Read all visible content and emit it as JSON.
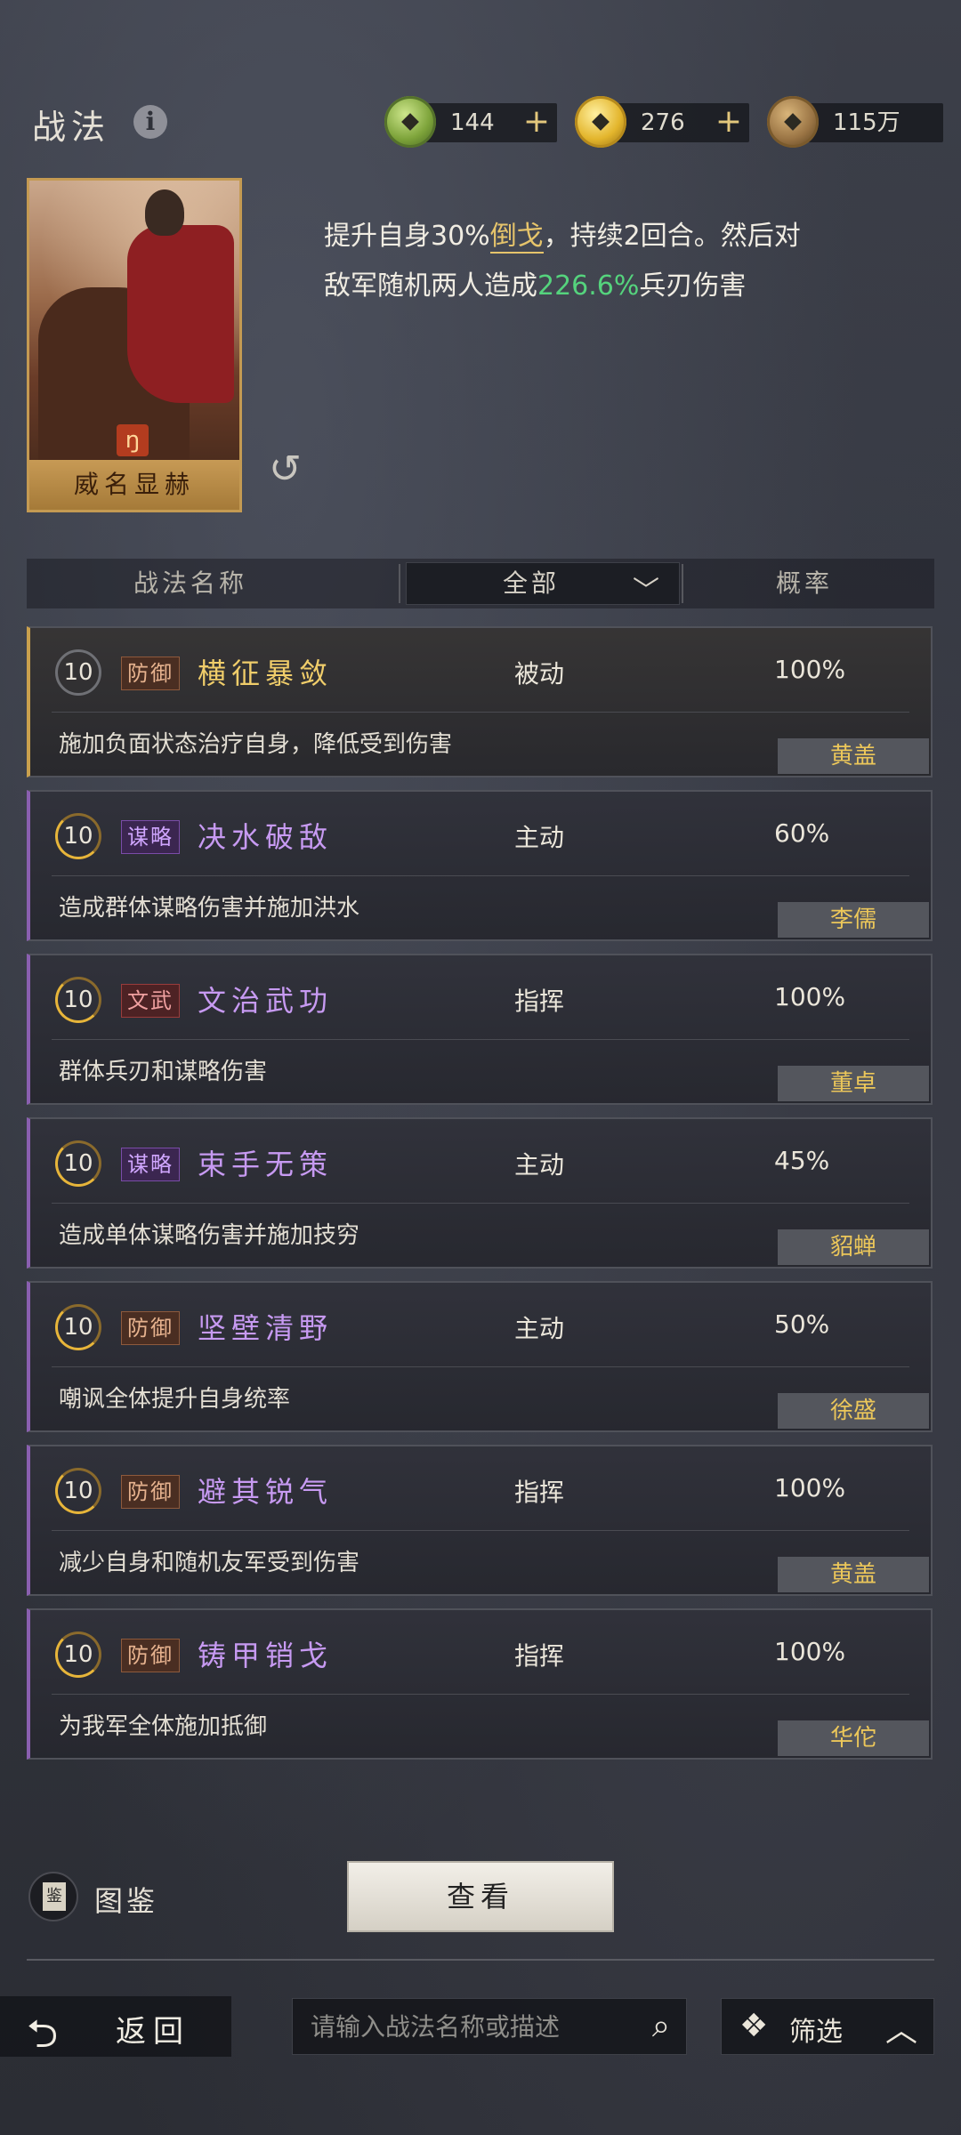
{
  "header": {
    "title": "战法",
    "resources": [
      {
        "name": "jade",
        "value": "144",
        "plus": "+"
      },
      {
        "name": "gold",
        "value": "276",
        "plus": "+"
      },
      {
        "name": "copper",
        "value": "115万",
        "plus": ""
      }
    ]
  },
  "featured": {
    "card_name": "威名显赫",
    "desc_1": "提升自身30%",
    "keyword": "倒戈",
    "desc_2": "，持续2回合。然后对",
    "desc_3": "敌军随机两人造成",
    "damage_value": "226.6%",
    "desc_4": "兵刃伤害"
  },
  "filter": {
    "name_header": "战法名称",
    "category": "全部",
    "rate_header": "概率"
  },
  "skills": [
    {
      "level": "10",
      "tag": "防御",
      "name": "横征暴敛",
      "type": "被动",
      "rate": "100%",
      "desc": "施加负面状态治疗自身，降低受到伤害",
      "owner": "黄盖"
    },
    {
      "level": "10",
      "tag": "谋略",
      "name": "决水破敌",
      "type": "主动",
      "rate": "60%",
      "desc": "造成群体谋略伤害并施加洪水",
      "owner": "李儒"
    },
    {
      "level": "10",
      "tag": "文武",
      "name": "文治武功",
      "type": "指挥",
      "rate": "100%",
      "desc": "群体兵刃和谋略伤害",
      "owner": "董卓"
    },
    {
      "level": "10",
      "tag": "谋略",
      "name": "束手无策",
      "type": "主动",
      "rate": "45%",
      "desc": "造成单体谋略伤害并施加技穷",
      "owner": "貂蝉"
    },
    {
      "level": "10",
      "tag": "防御",
      "name": "坚壁清野",
      "type": "主动",
      "rate": "50%",
      "desc": "嘲讽全体提升自身统率",
      "owner": "徐盛"
    },
    {
      "level": "10",
      "tag": "防御",
      "name": "避其锐气",
      "type": "指挥",
      "rate": "100%",
      "desc": "减少自身和随机友军受到伤害",
      "owner": "黄盖"
    },
    {
      "level": "10",
      "tag": "防御",
      "name": "铸甲销戈",
      "type": "指挥",
      "rate": "100%",
      "desc": "为我军全体施加抵御",
      "owner": "华佗"
    }
  ],
  "bottom": {
    "encyclopedia": "图鉴",
    "encyclopedia_icon_char": "鉴",
    "view_button": "查看",
    "back": "返回",
    "search_placeholder": "请输入战法名称或描述",
    "filter_label": "筛选"
  }
}
